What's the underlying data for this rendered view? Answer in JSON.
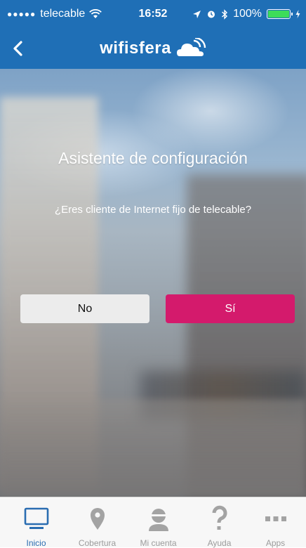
{
  "status_bar": {
    "signal_dots": "●●●●●",
    "carrier": "telecable",
    "time": "16:52",
    "battery": "100%"
  },
  "nav": {
    "logo_text": "wifisfera"
  },
  "main": {
    "title": "Asistente de configuración",
    "question": "¿Eres cliente de Internet fijo de telecable?",
    "no_label": "No",
    "yes_label": "Sí"
  },
  "tabs": [
    {
      "label": "Inicio",
      "icon": "monitor-icon"
    },
    {
      "label": "Cobertura",
      "icon": "map-pin-icon"
    },
    {
      "label": "Mi cuenta",
      "icon": "user-icon"
    },
    {
      "label": "Ayuda",
      "icon": "question-icon"
    },
    {
      "label": "Apps",
      "icon": "apps-icon"
    }
  ],
  "colors": {
    "header": "#1f6fb6",
    "yes_button": "#d41a6c",
    "active_tab": "#2a6db1",
    "inactive_tab": "#9b9b9b"
  }
}
